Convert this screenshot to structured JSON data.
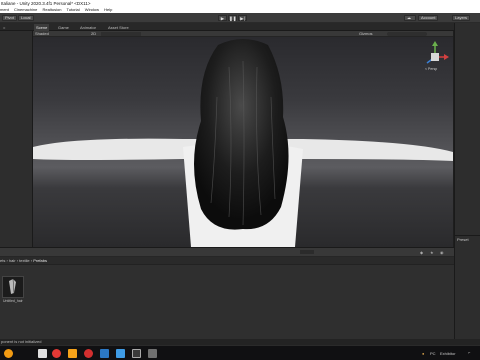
{
  "window": {
    "title": "Italiane - Unity 2020.3.4f1 Personal* <DX11>"
  },
  "menubar": {
    "items": [
      "ment",
      "Cinemachine",
      "Realtusion",
      "Tutorial",
      "Window",
      "Help"
    ]
  },
  "toolbar": {
    "pivot_label": "Pivot",
    "local_label": "Local",
    "account_label": "Account",
    "layers_label": "Layers"
  },
  "tabs": {
    "left_top": "=",
    "scene": "Scene",
    "game": "Game",
    "animator": "Animator",
    "asset_store": "Asset Store",
    "inspector": "Inspector"
  },
  "scene_toolbar": {
    "shading_label": "Shaded",
    "mode_label": "2D",
    "gizmos_label": "Gizmos"
  },
  "scene_gizmo": {
    "persp_label": "< Persp"
  },
  "presets_panel": {
    "title": "Preset"
  },
  "project": {
    "breadcrumb": [
      "ets",
      "hair",
      "textile",
      "Prefabs"
    ],
    "asset_name": "Untitled_hair"
  },
  "status": {
    "message": "ponent is not initialized"
  },
  "taskbar": {
    "user_label": "PC",
    "place_label": "Exhibitor",
    "counter_label": "⌐"
  },
  "colors": {
    "accent": "#4a7fc1",
    "gizmo_x": "#d34040",
    "gizmo_y": "#6ab04c",
    "gizmo_z": "#3a7fd4"
  }
}
